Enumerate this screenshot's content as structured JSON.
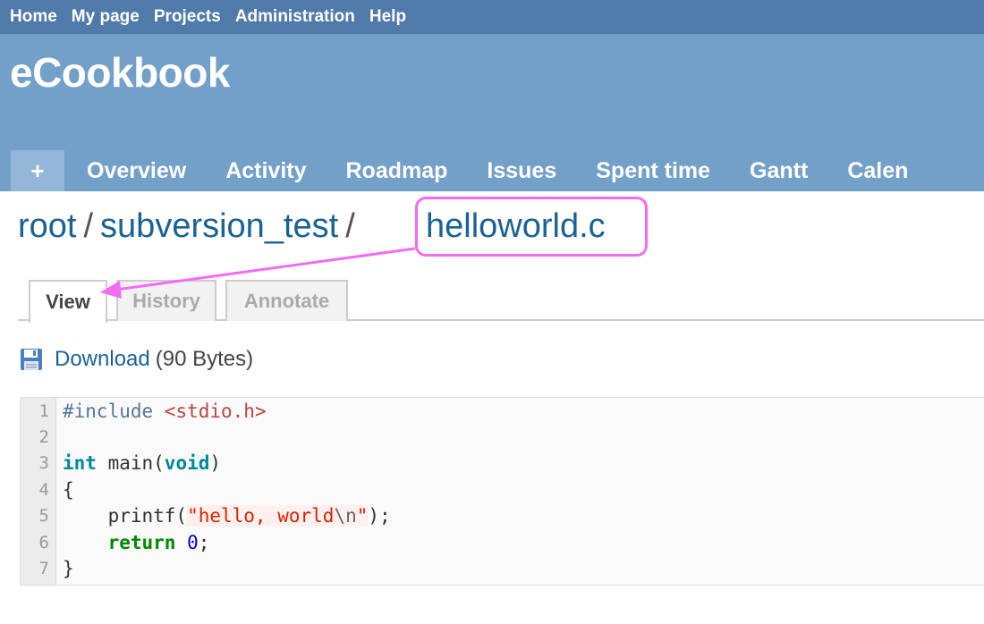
{
  "top_menu": [
    "Home",
    "My page",
    "Projects",
    "Administration",
    "Help"
  ],
  "site_title": "eCookbook",
  "main_menu": {
    "new_label": "+",
    "tabs": [
      "Overview",
      "Activity",
      "Roadmap",
      "Issues",
      "Spent time",
      "Gantt",
      "Calen"
    ]
  },
  "breadcrumb": {
    "root": "root",
    "sep": "/",
    "repo": "subversion_test",
    "file": "helloworld.c"
  },
  "tabs": {
    "view": "View",
    "history": "History",
    "annotate": "Annotate"
  },
  "download": {
    "label": "Download",
    "size": "(90 Bytes)"
  },
  "code": {
    "line_numbers": [
      "1",
      "2",
      "3",
      "4",
      "5",
      "6",
      "7"
    ],
    "l1a": "#include ",
    "l1b": "<stdio.h>",
    "l3a": "int",
    "l3b": " main(",
    "l3c": "void",
    "l3d": ")",
    "l4": "{",
    "l5a": "    printf(",
    "l5b": "\"hello, world",
    "l5c": "\\n",
    "l5d": "\"",
    "l5e": ");",
    "l6a": "    ",
    "l6b": "return",
    "l6c": " ",
    "l6d": "0",
    "l6e": ";",
    "l7": "}"
  },
  "colors": {
    "top_bar": "#507aaa",
    "header": "#73a0c8",
    "link": "#1b6294",
    "highlight": "#f26cf2"
  }
}
